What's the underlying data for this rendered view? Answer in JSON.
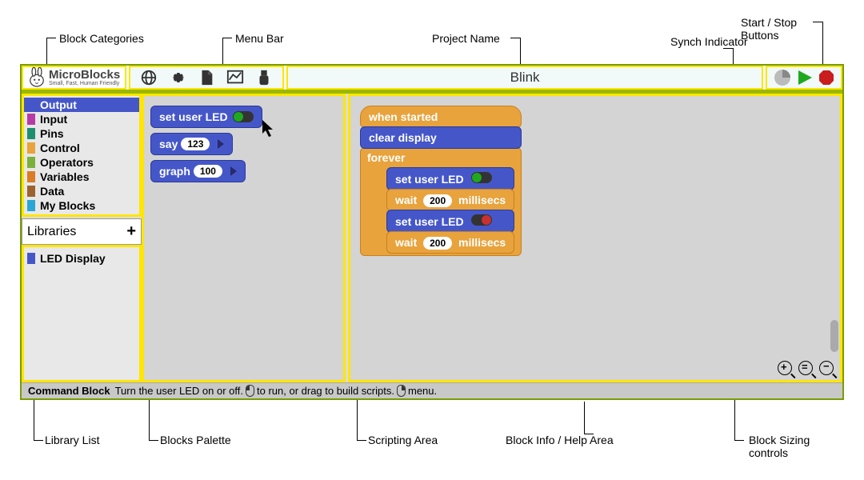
{
  "callouts": {
    "blockCategories": "Block Categories",
    "menuBar": "Menu Bar",
    "projectName": "Project Name",
    "synchIndicator": "Synch Indicator",
    "startStop": "Start / Stop Buttons",
    "libraryList": "Library List",
    "blocksPalette": "Blocks Palette",
    "scriptingArea": "Scripting Area",
    "blockInfo": "Block Info / Help Area",
    "blockSizing": "Block Sizing controls"
  },
  "logo": {
    "title": "MicroBlocks",
    "subtitle": "Small, Fast, Human Friendly"
  },
  "projectName": "Blink",
  "categories": [
    {
      "label": "Output",
      "color": "#4557c8",
      "selected": true
    },
    {
      "label": "Input",
      "color": "#b83aa7"
    },
    {
      "label": "Pins",
      "color": "#1e8f6e"
    },
    {
      "label": "Control",
      "color": "#e8a33d"
    },
    {
      "label": "Operators",
      "color": "#7bb03c"
    },
    {
      "label": "Variables",
      "color": "#d97d28"
    },
    {
      "label": "Data",
      "color": "#9c6330"
    },
    {
      "label": "My Blocks",
      "color": "#2aa7d4"
    }
  ],
  "librariesLabel": "Libraries",
  "libraries": [
    {
      "label": "LED Display"
    }
  ],
  "paletteBlocks": {
    "setUserLed": "set user LED",
    "say": "say",
    "sayVal": "123",
    "graph": "graph",
    "graphVal": "100"
  },
  "script": {
    "whenStarted": "when started",
    "clearDisplay": "clear display",
    "forever": "forever",
    "setUserLed": "set user LED",
    "wait": "wait",
    "waitVal": "200",
    "millisecs": "millisecs"
  },
  "help": {
    "title": "Command Block",
    "body1": "Turn the user LED on or off.",
    "body2": "to run, or drag to build scripts.",
    "body3": "menu."
  }
}
